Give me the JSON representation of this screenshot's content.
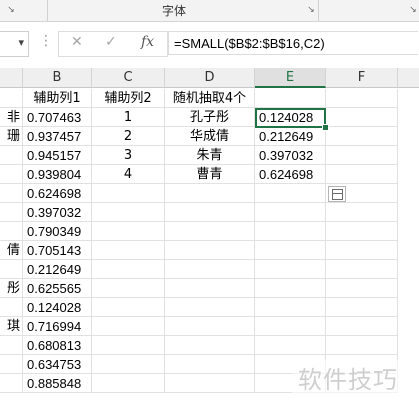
{
  "ribbon": {
    "group_label": "字体",
    "launcher_glyph": "↘"
  },
  "formula_bar": {
    "namebox_dropdown": "▾",
    "dots": "⋮",
    "cancel_glyph": "✕",
    "enter_glyph": "✓",
    "fx_glyph": "fx",
    "formula": "=SMALL($B$2:$B$16,C2)"
  },
  "columns": [
    "B",
    "C",
    "D",
    "E",
    "F"
  ],
  "active_column": "E",
  "headers_row1": {
    "B": "辅助列1",
    "C": "辅助列2",
    "D": "随机抽取4个"
  },
  "col_a_fragments": [
    "非",
    "珊",
    "",
    "",
    "",
    "",
    "",
    "倩",
    "",
    "彤",
    "",
    "琪",
    "",
    ""
  ],
  "col_b_values": [
    "0.707463",
    "0.937457",
    "0.945157",
    "0.939804",
    "0.624698",
    "0.397032",
    "0.790349",
    "0.705143",
    "0.212649",
    "0.625565",
    "0.124028",
    "0.716994",
    "0.680813",
    "0.634753",
    "0.885848"
  ],
  "col_c_values": [
    "1",
    "2",
    "3",
    "4"
  ],
  "col_d_values": [
    "孔子彤",
    "华成倩",
    "朱青",
    "曹青"
  ],
  "col_e_values": [
    "0.124028",
    "0.212649",
    "0.397032",
    "0.624698"
  ],
  "selected_cell": "E2",
  "watermark": "软件技巧",
  "accent_color": "#217346"
}
